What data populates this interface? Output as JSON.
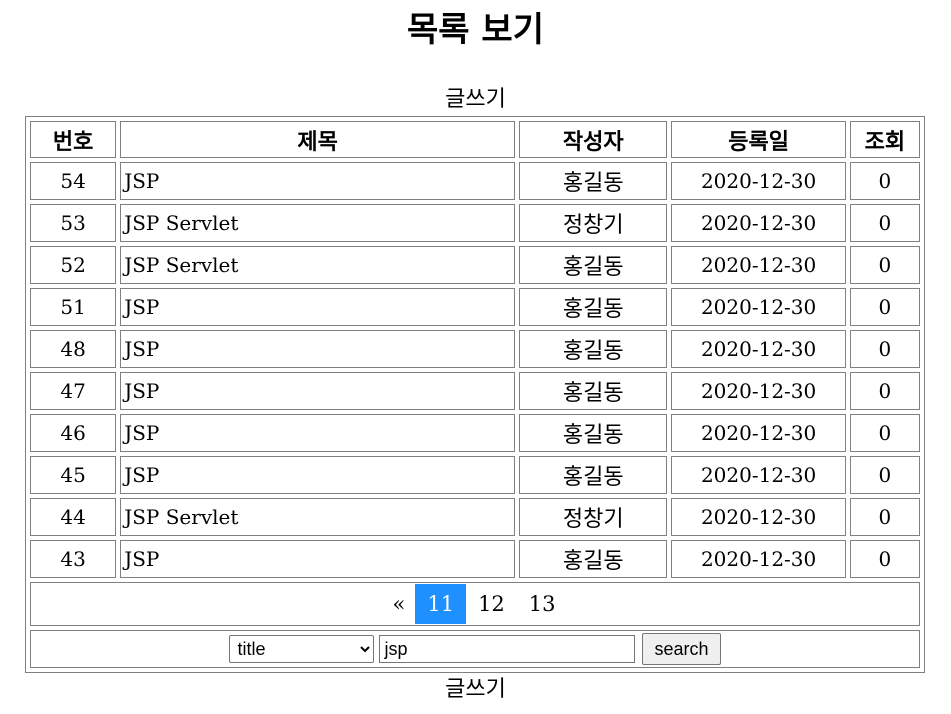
{
  "page": {
    "title": "목록 보기",
    "write_label": "글쓰기"
  },
  "table": {
    "headers": [
      "번호",
      "제목",
      "작성자",
      "등록일",
      "조회"
    ],
    "rows": [
      {
        "num": "54",
        "title": "JSP",
        "author": "홍길동",
        "date": "2020-12-30",
        "views": "0"
      },
      {
        "num": "53",
        "title": "JSP Servlet",
        "author": "정창기",
        "date": "2020-12-30",
        "views": "0"
      },
      {
        "num": "52",
        "title": "JSP Servlet",
        "author": "홍길동",
        "date": "2020-12-30",
        "views": "0"
      },
      {
        "num": "51",
        "title": "JSP",
        "author": "홍길동",
        "date": "2020-12-30",
        "views": "0"
      },
      {
        "num": "48",
        "title": "JSP",
        "author": "홍길동",
        "date": "2020-12-30",
        "views": "0"
      },
      {
        "num": "47",
        "title": "JSP",
        "author": "홍길동",
        "date": "2020-12-30",
        "views": "0"
      },
      {
        "num": "46",
        "title": "JSP",
        "author": "홍길동",
        "date": "2020-12-30",
        "views": "0"
      },
      {
        "num": "45",
        "title": "JSP",
        "author": "홍길동",
        "date": "2020-12-30",
        "views": "0"
      },
      {
        "num": "44",
        "title": "JSP Servlet",
        "author": "정창기",
        "date": "2020-12-30",
        "views": "0"
      },
      {
        "num": "43",
        "title": "JSP",
        "author": "홍길동",
        "date": "2020-12-30",
        "views": "0"
      }
    ]
  },
  "pagination": {
    "prev_label": "«",
    "pages": [
      "11",
      "12",
      "13"
    ],
    "current": "11",
    "active_color": "#1e90ff"
  },
  "search": {
    "field_selected": "title",
    "query_value": "jsp",
    "button_label": "search"
  }
}
